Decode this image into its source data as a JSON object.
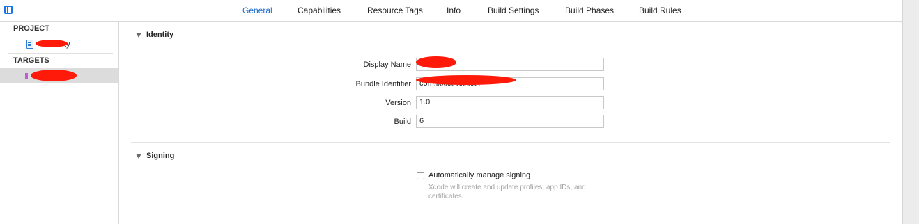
{
  "tabs": [
    {
      "label": "General",
      "active": true
    },
    {
      "label": "Capabilities"
    },
    {
      "label": "Resource Tags"
    },
    {
      "label": "Info"
    },
    {
      "label": "Build Settings"
    },
    {
      "label": "Build Phases"
    },
    {
      "label": "Build Rules"
    }
  ],
  "sidebar": {
    "project_header": "PROJECT",
    "project_item_suffix": "ty",
    "targets_header": "TARGETS"
  },
  "identity": {
    "title": "Identity",
    "display_name_label": "Display Name",
    "display_name_value": "",
    "bundle_identifier_label": "Bundle Identifier",
    "bundle_identifier_value": "com.ixxxxxxxxxxx",
    "version_label": "Version",
    "version_value": "1.0",
    "build_label": "Build",
    "build_value": "6"
  },
  "signing": {
    "title": "Signing",
    "auto_manage_label": "Automatically manage signing",
    "auto_manage_checked": false,
    "auto_manage_hint": "Xcode will create and update profiles, app IDs, and certificates."
  },
  "colors": {
    "accent": "#1f6fd1",
    "redaction": "#ff1a0a",
    "selected_row": "#dcdcdc"
  }
}
